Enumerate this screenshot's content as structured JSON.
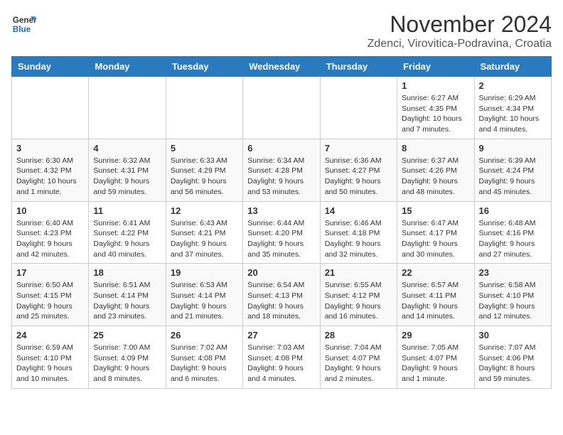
{
  "logo": {
    "line1": "General",
    "line2": "Blue"
  },
  "title": "November 2024",
  "subtitle": "Zdenci, Virovitica-Podravina, Croatia",
  "headers": [
    "Sunday",
    "Monday",
    "Tuesday",
    "Wednesday",
    "Thursday",
    "Friday",
    "Saturday"
  ],
  "weeks": [
    [
      {
        "day": "",
        "info": ""
      },
      {
        "day": "",
        "info": ""
      },
      {
        "day": "",
        "info": ""
      },
      {
        "day": "",
        "info": ""
      },
      {
        "day": "",
        "info": ""
      },
      {
        "day": "1",
        "info": "Sunrise: 6:27 AM\nSunset: 4:35 PM\nDaylight: 10 hours and 7 minutes."
      },
      {
        "day": "2",
        "info": "Sunrise: 6:29 AM\nSunset: 4:34 PM\nDaylight: 10 hours and 4 minutes."
      }
    ],
    [
      {
        "day": "3",
        "info": "Sunrise: 6:30 AM\nSunset: 4:32 PM\nDaylight: 10 hours and 1 minute."
      },
      {
        "day": "4",
        "info": "Sunrise: 6:32 AM\nSunset: 4:31 PM\nDaylight: 9 hours and 59 minutes."
      },
      {
        "day": "5",
        "info": "Sunrise: 6:33 AM\nSunset: 4:29 PM\nDaylight: 9 hours and 56 minutes."
      },
      {
        "day": "6",
        "info": "Sunrise: 6:34 AM\nSunset: 4:28 PM\nDaylight: 9 hours and 53 minutes."
      },
      {
        "day": "7",
        "info": "Sunrise: 6:36 AM\nSunset: 4:27 PM\nDaylight: 9 hours and 50 minutes."
      },
      {
        "day": "8",
        "info": "Sunrise: 6:37 AM\nSunset: 4:26 PM\nDaylight: 9 hours and 48 minutes."
      },
      {
        "day": "9",
        "info": "Sunrise: 6:39 AM\nSunset: 4:24 PM\nDaylight: 9 hours and 45 minutes."
      }
    ],
    [
      {
        "day": "10",
        "info": "Sunrise: 6:40 AM\nSunset: 4:23 PM\nDaylight: 9 hours and 42 minutes."
      },
      {
        "day": "11",
        "info": "Sunrise: 6:41 AM\nSunset: 4:22 PM\nDaylight: 9 hours and 40 minutes."
      },
      {
        "day": "12",
        "info": "Sunrise: 6:43 AM\nSunset: 4:21 PM\nDaylight: 9 hours and 37 minutes."
      },
      {
        "day": "13",
        "info": "Sunrise: 6:44 AM\nSunset: 4:20 PM\nDaylight: 9 hours and 35 minutes."
      },
      {
        "day": "14",
        "info": "Sunrise: 6:46 AM\nSunset: 4:18 PM\nDaylight: 9 hours and 32 minutes."
      },
      {
        "day": "15",
        "info": "Sunrise: 6:47 AM\nSunset: 4:17 PM\nDaylight: 9 hours and 30 minutes."
      },
      {
        "day": "16",
        "info": "Sunrise: 6:48 AM\nSunset: 4:16 PM\nDaylight: 9 hours and 27 minutes."
      }
    ],
    [
      {
        "day": "17",
        "info": "Sunrise: 6:50 AM\nSunset: 4:15 PM\nDaylight: 9 hours and 25 minutes."
      },
      {
        "day": "18",
        "info": "Sunrise: 6:51 AM\nSunset: 4:14 PM\nDaylight: 9 hours and 23 minutes."
      },
      {
        "day": "19",
        "info": "Sunrise: 6:53 AM\nSunset: 4:14 PM\nDaylight: 9 hours and 21 minutes."
      },
      {
        "day": "20",
        "info": "Sunrise: 6:54 AM\nSunset: 4:13 PM\nDaylight: 9 hours and 18 minutes."
      },
      {
        "day": "21",
        "info": "Sunrise: 6:55 AM\nSunset: 4:12 PM\nDaylight: 9 hours and 16 minutes."
      },
      {
        "day": "22",
        "info": "Sunrise: 6:57 AM\nSunset: 4:11 PM\nDaylight: 9 hours and 14 minutes."
      },
      {
        "day": "23",
        "info": "Sunrise: 6:58 AM\nSunset: 4:10 PM\nDaylight: 9 hours and 12 minutes."
      }
    ],
    [
      {
        "day": "24",
        "info": "Sunrise: 6:59 AM\nSunset: 4:10 PM\nDaylight: 9 hours and 10 minutes."
      },
      {
        "day": "25",
        "info": "Sunrise: 7:00 AM\nSunset: 4:09 PM\nDaylight: 9 hours and 8 minutes."
      },
      {
        "day": "26",
        "info": "Sunrise: 7:02 AM\nSunset: 4:08 PM\nDaylight: 9 hours and 6 minutes."
      },
      {
        "day": "27",
        "info": "Sunrise: 7:03 AM\nSunset: 4:08 PM\nDaylight: 9 hours and 4 minutes."
      },
      {
        "day": "28",
        "info": "Sunrise: 7:04 AM\nSunset: 4:07 PM\nDaylight: 9 hours and 2 minutes."
      },
      {
        "day": "29",
        "info": "Sunrise: 7:05 AM\nSunset: 4:07 PM\nDaylight: 9 hours and 1 minute."
      },
      {
        "day": "30",
        "info": "Sunrise: 7:07 AM\nSunset: 4:06 PM\nDaylight: 8 hours and 59 minutes."
      }
    ]
  ]
}
